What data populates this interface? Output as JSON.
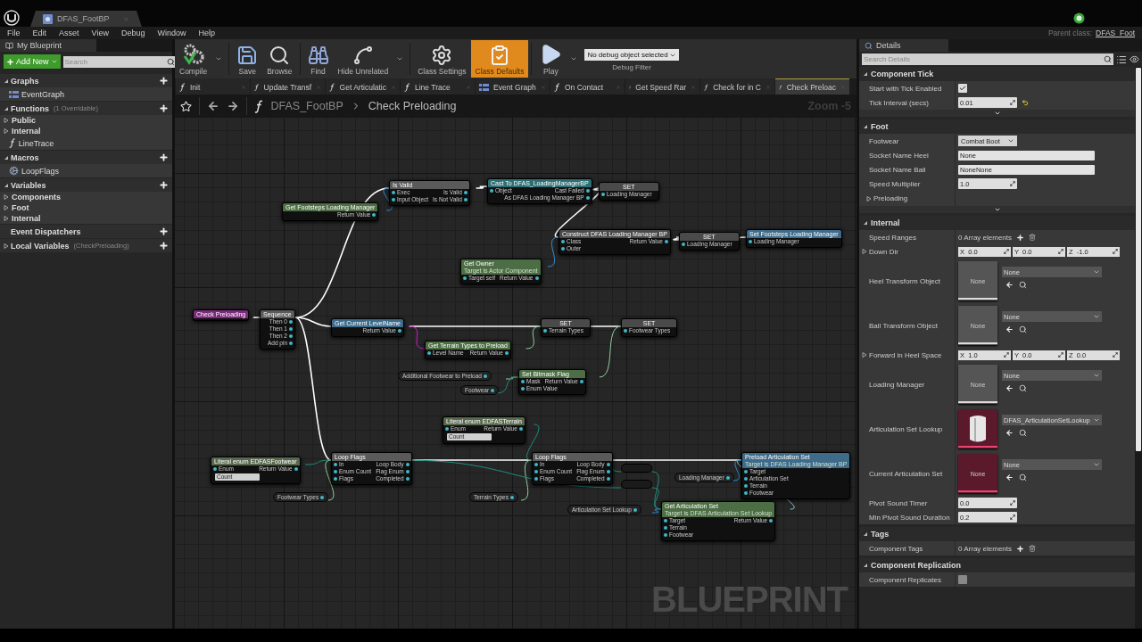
{
  "window": {
    "tab": "DFAS_FootBP",
    "parent_label": "Parent class:",
    "parent_value": "DFAS_Foot"
  },
  "menu": [
    "File",
    "Edit",
    "Asset",
    "View",
    "Debug",
    "Window",
    "Help"
  ],
  "left_panel": {
    "tab": "My Blueprint",
    "add_button": "Add New",
    "search": {
      "placeholder": "Search"
    },
    "sections": [
      {
        "title": "Graphs",
        "expanded": true,
        "items": [
          {
            "kind": "graph",
            "label": "EventGraph"
          }
        ]
      },
      {
        "title": "Functions",
        "note": "(1 Overridable)",
        "expanded": true,
        "items": [
          {
            "kind": "category",
            "label": "Public"
          },
          {
            "kind": "category",
            "label": "Internal"
          },
          {
            "kind": "function",
            "label": "LineTrace"
          }
        ]
      },
      {
        "title": "Macros",
        "expanded": true,
        "items": [
          {
            "kind": "macro",
            "label": "LoopFlags"
          }
        ]
      },
      {
        "title": "Variables",
        "expanded": true,
        "items": [
          {
            "kind": "category",
            "label": "Components"
          },
          {
            "kind": "category",
            "label": "Foot"
          },
          {
            "kind": "category",
            "label": "Internal"
          }
        ]
      },
      {
        "title": "Event Dispatchers",
        "expanded": true
      },
      {
        "title": "Local Variables",
        "note": "(CheckPreloading)",
        "expanded": false
      }
    ]
  },
  "toolbar": {
    "buttons": [
      {
        "label": "Compile",
        "menu": true,
        "selected": false
      },
      {
        "label": "Save",
        "menu": false,
        "selected": false
      },
      {
        "label": "Browse",
        "menu": false,
        "selected": false
      },
      {
        "label": "Find",
        "menu": false,
        "selected": false
      },
      {
        "label": "Hide Unrelated",
        "menu": true,
        "selected": false
      },
      {
        "label": "Class Settings",
        "menu": false,
        "selected": false
      },
      {
        "label": "Class Defaults",
        "menu": false,
        "selected": true
      },
      {
        "label": "Play",
        "menu": true,
        "selected": false
      }
    ],
    "debug": {
      "value": "No debug object selected",
      "label": "Debug Filter"
    }
  },
  "graph_tabs": [
    {
      "kind": "function",
      "label": "Init",
      "selected": false
    },
    {
      "kind": "function",
      "label": "Update Transf",
      "selected": false
    },
    {
      "kind": "function",
      "label": "Get Articulatic",
      "selected": false
    },
    {
      "kind": "function",
      "label": "Line Trace",
      "selected": false
    },
    {
      "kind": "graph",
      "label": "Event Graph",
      "selected": false
    },
    {
      "kind": "function",
      "label": "On Contact",
      "selected": false
    },
    {
      "kind": "function",
      "label": "Get Speed Rar",
      "selected": false
    },
    {
      "kind": "function",
      "label": "Check for in C",
      "selected": false
    },
    {
      "kind": "function",
      "label": "Check Preloac",
      "selected": true
    }
  ],
  "breadcrumb": {
    "blueprint": "DFAS_FootBP",
    "graph": "Check Preloading",
    "zoom": "Zoom -5"
  },
  "graph": {
    "watermark": "BLUEPRINT",
    "nodes": [
      {
        "kind": "macro",
        "title": "Is Valid",
        "inputs": [
          "Exec",
          "Input Object"
        ],
        "outputs": [
          "Is Valid",
          "Is Not Valid"
        ]
      },
      {
        "kind": "cast",
        "title": "Cast To DFAS_LoadingManagerBP",
        "inputs": [
          "Object"
        ],
        "outputs": [
          "Cast Failed",
          "As DFAS Loading Manager BP"
        ]
      },
      {
        "kind": "set",
        "title": "SET",
        "inputs": [
          "Loading Manager"
        ]
      },
      {
        "kind": "function",
        "title": "Get Footsteps Loading Manager",
        "outputs": [
          "Return Value"
        ]
      },
      {
        "kind": "construct",
        "title": "Construct DFAS Loading Manager BP",
        "inputs": [
          "Class",
          "Outer"
        ],
        "outputs": [
          "Return Value"
        ]
      },
      {
        "kind": "set",
        "title": "SET",
        "inputs": [
          "Loading Manager"
        ]
      },
      {
        "kind": "call",
        "title": "Set Footsteps Loading Manager",
        "inputs": [
          "Loading Manager"
        ]
      },
      {
        "kind": "function",
        "title": "Get Owner",
        "subtitle": "Target is Actor Component",
        "inputs": [
          "Target self"
        ],
        "outputs": [
          "Return Value"
        ]
      },
      {
        "kind": "event",
        "title": "Check Preloading"
      },
      {
        "kind": "macro",
        "title": "Sequence",
        "outputs": [
          "Then 0",
          "Then 1",
          "Then 2",
          "Add pin"
        ]
      },
      {
        "kind": "call",
        "title": "Get Current LevelName",
        "outputs": [
          "Return Value"
        ]
      },
      {
        "kind": "set",
        "title": "SET",
        "inputs": [
          "Terrain Types"
        ]
      },
      {
        "kind": "set",
        "title": "SET",
        "inputs": [
          "Footwear Types"
        ]
      },
      {
        "kind": "function",
        "title": "Get Terrain Types to Preload",
        "inputs": [
          "Level Name"
        ],
        "outputs": [
          "Return Value"
        ]
      },
      {
        "kind": "getter",
        "title": "Additional Footwear to Preload"
      },
      {
        "kind": "getter",
        "title": "Footwear"
      },
      {
        "kind": "function",
        "title": "Set Bitmask Flag",
        "inputs": [
          "Mask",
          "Enum Value"
        ],
        "outputs": [
          "Return Value"
        ]
      },
      {
        "kind": "literal",
        "title": "Literal enum EDFASFootwear",
        "inputs": [
          "Enum"
        ],
        "outputs": [
          "Return Value"
        ],
        "dropdown": "Count"
      },
      {
        "kind": "getter",
        "title": "Footwear Types"
      },
      {
        "kind": "macro",
        "title": "Loop Flags",
        "inputs": [
          "In",
          "Enum Count",
          "Flags"
        ],
        "outputs": [
          "Loop Body",
          "Flag Enum",
          "Completed"
        ]
      },
      {
        "kind": "literal",
        "title": "Literal enum EDFASTerrain",
        "inputs": [
          "Enum"
        ],
        "outputs": [
          "Return Value"
        ],
        "dropdown": "Count"
      },
      {
        "kind": "getter",
        "title": "Terrain Types"
      },
      {
        "kind": "macro",
        "title": "Loop Flags",
        "inputs": [
          "In",
          "Enum Count",
          "Flags"
        ],
        "outputs": [
          "Loop Body",
          "Flag Enum",
          "Completed"
        ]
      },
      {
        "kind": "compact"
      },
      {
        "kind": "compact"
      },
      {
        "kind": "getter",
        "title": "Loading Manager"
      },
      {
        "kind": "call",
        "title": "Preload Articulation Set",
        "subtitle": "Target is DFAS Loading Manager BP",
        "inputs": [
          "Target",
          "Articulation Set",
          "Terrain",
          "Footwear"
        ]
      },
      {
        "kind": "getter",
        "title": "Articulation Set Lookup"
      },
      {
        "kind": "function",
        "title": "Get Articulation Set",
        "subtitle": "Target is DFAS Articulation Set Lookup",
        "inputs": [
          "Target",
          "Terrain",
          "Footwear"
        ],
        "outputs": [
          "Return Value"
        ]
      }
    ]
  },
  "details": {
    "tab": "Details",
    "search": {
      "placeholder": "Search Details"
    },
    "sections": [
      {
        "title": "Component Tick",
        "advanced": true,
        "rows": [
          {
            "kind": "checkbox",
            "label": "Start with Tick Enabled",
            "checked": true
          },
          {
            "kind": "number",
            "label": "Tick Interval (secs)",
            "value": "0.01",
            "modified": true
          }
        ]
      },
      {
        "title": "Foot",
        "advanced": true,
        "rows": [
          {
            "kind": "dropdown",
            "label": "Footwear",
            "value": "Combat Boot"
          },
          {
            "kind": "text",
            "label": "Socket Name Heel",
            "value": "None"
          },
          {
            "kind": "text",
            "label": "Socket Name Ball",
            "value": "NoneNone"
          },
          {
            "kind": "number",
            "label": "Speed Multiplier",
            "value": "1.0",
            "modified": false
          },
          {
            "kind": "subcategory",
            "label": "Preloading",
            "expanded": false
          }
        ]
      },
      {
        "title": "Internal",
        "advanced": false,
        "rows": [
          {
            "kind": "array",
            "label": "Speed Ranges",
            "value": "0 Array elements"
          },
          {
            "kind": "vector",
            "label": "Down Dir",
            "expanded": false,
            "values": [
              "X  0.0",
              "Y  0.0",
              "Z  -1.0"
            ]
          },
          {
            "kind": "asset",
            "label": "Heel Transform Object",
            "thumb": "None",
            "value": "None",
            "color": "#555555"
          },
          {
            "kind": "asset",
            "label": "Ball Transform Object",
            "thumb": "None",
            "value": "None",
            "color": "#555555"
          },
          {
            "kind": "vector",
            "label": "Forward in Heel Space",
            "expanded": false,
            "values": [
              "X  1.0",
              "Y  0.0",
              "Z  0.0"
            ]
          },
          {
            "kind": "asset",
            "label": "Loading Manager",
            "thumb": "None",
            "value": "None",
            "color": "#555555"
          },
          {
            "kind": "asset",
            "label": "Articulation Set Lookup",
            "value": "DFAS_ArticulationSetLookup",
            "color": "#5a1a2c"
          },
          {
            "kind": "asset",
            "label": "Current Articulation Set",
            "thumb": "None",
            "value": "None",
            "color": "#5a1a2c"
          },
          {
            "kind": "number",
            "label": "Pivot Sound Timer",
            "value": "0.0",
            "modified": false
          },
          {
            "kind": "number",
            "label": "Min Pivot Sound Duration",
            "value": "0.2",
            "modified": false
          }
        ]
      },
      {
        "title": "Tags",
        "advanced": false,
        "rows": [
          {
            "kind": "array",
            "label": "Component Tags",
            "value": "0 Array elements"
          }
        ]
      },
      {
        "title": "Component Replication",
        "advanced": false,
        "rows": [
          {
            "kind": "checkbox",
            "label": "Component Replicates",
            "checked": false
          }
        ]
      }
    ]
  }
}
